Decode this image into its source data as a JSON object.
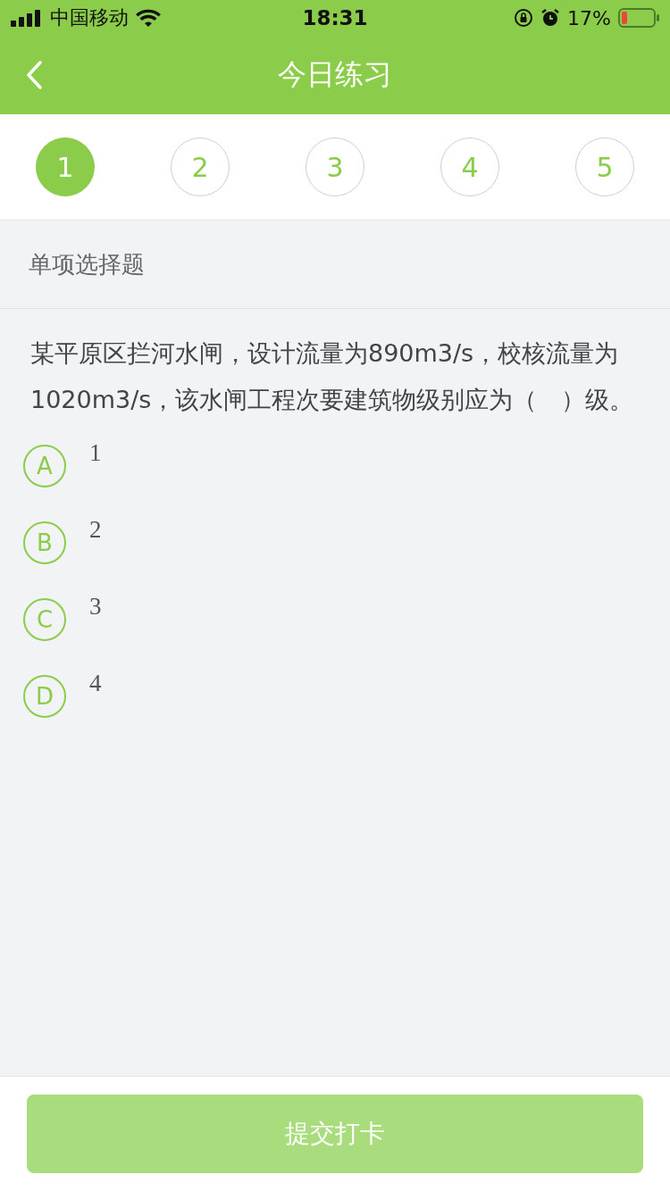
{
  "status_bar": {
    "carrier": "中国移动",
    "time": "18:31",
    "battery": "17%"
  },
  "nav": {
    "title": "今日练习"
  },
  "steps": [
    {
      "label": "1",
      "selected": true
    },
    {
      "label": "2",
      "selected": false
    },
    {
      "label": "3",
      "selected": false
    },
    {
      "label": "4",
      "selected": false
    },
    {
      "label": "5",
      "selected": false
    }
  ],
  "section": "单项选择题",
  "question": "某平原区拦河水闸，设计流量为890m3/s，校核流量为1020m3/s，该水闸工程次要建筑物级别应为（　）级。",
  "options": [
    {
      "letter": "A",
      "text": "1",
      "selected": false
    },
    {
      "letter": "B",
      "text": "2",
      "selected": false
    },
    {
      "letter": "C",
      "text": "3",
      "selected": false
    },
    {
      "letter": "D",
      "text": "4",
      "selected": false
    }
  ],
  "submit": {
    "label": "提交打卡",
    "disabled": true
  }
}
